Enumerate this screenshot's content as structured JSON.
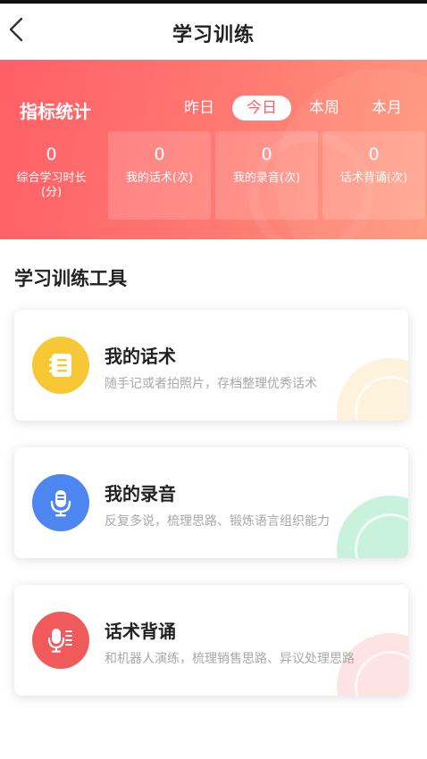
{
  "header": {
    "title": "学习训练"
  },
  "stats": {
    "title": "指标统计",
    "periods": [
      "昨日",
      "今日",
      "本周",
      "本月"
    ],
    "active_period": "今日",
    "items": [
      {
        "value": "0",
        "label": "综合学习时长(分)"
      },
      {
        "value": "0",
        "label": "我的话术(次)"
      },
      {
        "value": "0",
        "label": "我的录音(次)"
      },
      {
        "value": "0",
        "label": "话术背诵(次)"
      }
    ]
  },
  "tools_section": {
    "title": "学习训练工具",
    "items": [
      {
        "name": "我的话术",
        "desc": "随手记或者拍照片，存档整理优秀话术",
        "icon": "notebook-icon",
        "color": "#f7c836",
        "accent": "#fdf0d0"
      },
      {
        "name": "我的录音",
        "desc": "反复多说，梳理思路、锻炼语言组织能力",
        "icon": "microphone-icon",
        "color": "#4d86f0",
        "accent": "#c9f2dd"
      },
      {
        "name": "话术背诵",
        "desc": "和机器人演练，梳理销售思路、异议处理思路",
        "icon": "microphone-text-icon",
        "color": "#f05a5a",
        "accent": "#fde1e1"
      }
    ]
  }
}
